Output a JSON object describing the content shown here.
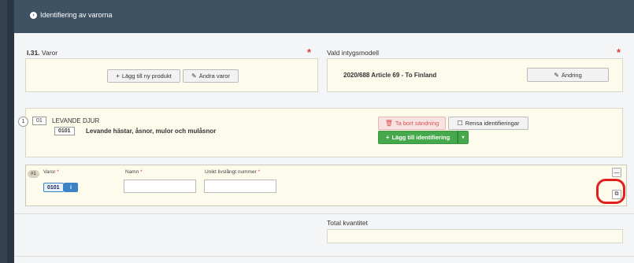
{
  "header": {
    "title": "Identifiering av varorna"
  },
  "goods_section": {
    "code": "I.31.",
    "label": "Varor",
    "add_product_label": "Lägg till ny produkt",
    "edit_goods_label": "Ändra varor"
  },
  "certificate_model": {
    "label": "Vald intygsmodell",
    "value": "2020/688 Article 69 - To Finland",
    "change_label": "Ändring"
  },
  "shipment": {
    "index": "1",
    "chapter_code": "01",
    "chapter_name": "LEVANDE DJUR",
    "heading_code": "0101",
    "heading_name": "Levande hästar, åsnor, mulor och mulåsnor",
    "remove_label": "Ta bort sändning",
    "clear_label": "Rensa identifieringar",
    "add_identification_label": "Lägg till identifiering"
  },
  "identification_row": {
    "index_label": "#1",
    "col_goods": "Varor",
    "col_name": "Namn",
    "col_unique_id": "Unikt livslångt nummer",
    "goods_code": "0101",
    "name_value": "",
    "unique_id_value": ""
  },
  "total": {
    "label": "Total kvantitet",
    "value": ""
  },
  "colors": {
    "required": "#e23b3b",
    "green": "#45a84a",
    "blue": "#3a83c4",
    "highlight_ring": "#e21f1f"
  }
}
